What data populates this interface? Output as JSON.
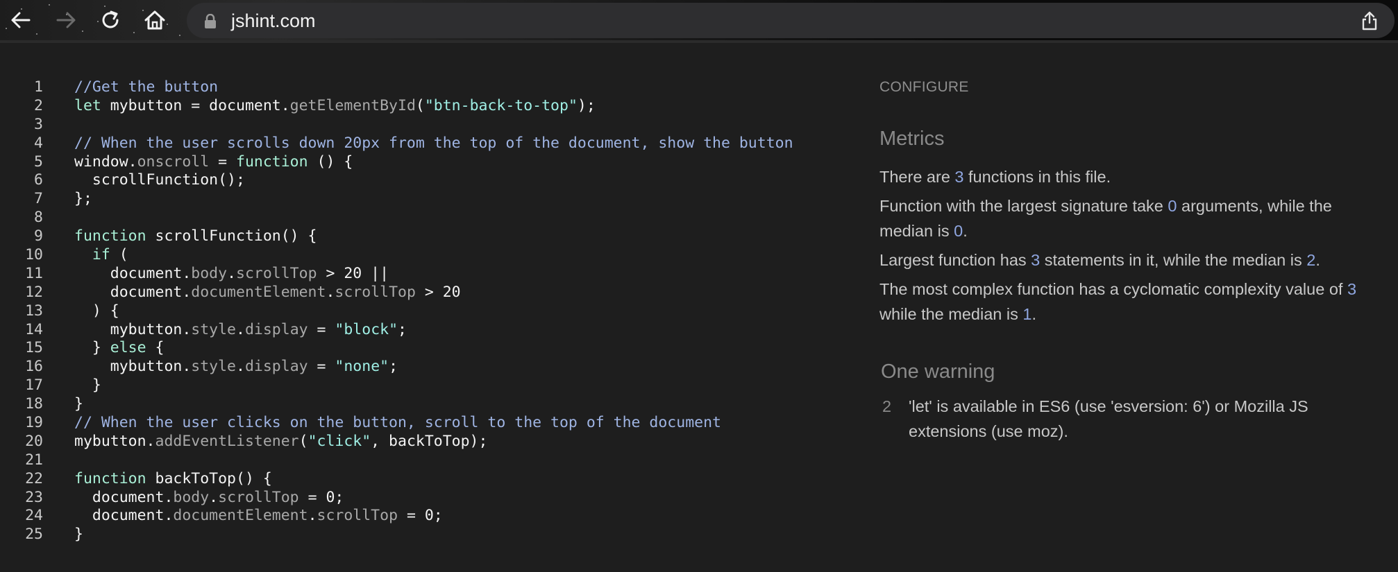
{
  "browser": {
    "url": "jshint.com"
  },
  "code": {
    "lines": [
      {
        "n": "1",
        "tokens": [
          {
            "t": "//Get the button",
            "c": "comment"
          }
        ]
      },
      {
        "n": "2",
        "tokens": [
          {
            "t": "let",
            "c": "keyword"
          },
          {
            "t": " mybutton = document.",
            "c": "plain"
          },
          {
            "t": "getElementById",
            "c": "prop"
          },
          {
            "t": "(",
            "c": "plain"
          },
          {
            "t": "\"btn-back-to-top\"",
            "c": "string"
          },
          {
            "t": ");",
            "c": "plain"
          }
        ]
      },
      {
        "n": "3",
        "tokens": []
      },
      {
        "n": "4",
        "tokens": [
          {
            "t": "// When the user scrolls down 20px from the top of the document, show the button",
            "c": "comment"
          }
        ]
      },
      {
        "n": "5",
        "tokens": [
          {
            "t": "window.",
            "c": "plain"
          },
          {
            "t": "onscroll",
            "c": "prop"
          },
          {
            "t": " = ",
            "c": "plain"
          },
          {
            "t": "function",
            "c": "keyword"
          },
          {
            "t": " () {",
            "c": "plain"
          }
        ]
      },
      {
        "n": "6",
        "tokens": [
          {
            "t": "  scrollFunction();",
            "c": "plain"
          }
        ]
      },
      {
        "n": "7",
        "tokens": [
          {
            "t": "};",
            "c": "plain"
          }
        ]
      },
      {
        "n": "8",
        "tokens": []
      },
      {
        "n": "9",
        "tokens": [
          {
            "t": "function",
            "c": "keyword"
          },
          {
            "t": " scrollFunction() {",
            "c": "plain"
          }
        ]
      },
      {
        "n": "10",
        "tokens": [
          {
            "t": "  ",
            "c": "plain"
          },
          {
            "t": "if",
            "c": "keyword"
          },
          {
            "t": " (",
            "c": "plain"
          }
        ]
      },
      {
        "n": "11",
        "tokens": [
          {
            "t": "    document.",
            "c": "plain"
          },
          {
            "t": "body",
            "c": "prop"
          },
          {
            "t": ".",
            "c": "plain"
          },
          {
            "t": "scrollTop",
            "c": "prop"
          },
          {
            "t": " > 20 ||",
            "c": "plain"
          }
        ]
      },
      {
        "n": "12",
        "tokens": [
          {
            "t": "    document.",
            "c": "plain"
          },
          {
            "t": "documentElement",
            "c": "prop"
          },
          {
            "t": ".",
            "c": "plain"
          },
          {
            "t": "scrollTop",
            "c": "prop"
          },
          {
            "t": " > 20",
            "c": "plain"
          }
        ]
      },
      {
        "n": "13",
        "tokens": [
          {
            "t": "  ) {",
            "c": "plain"
          }
        ]
      },
      {
        "n": "14",
        "tokens": [
          {
            "t": "    mybutton.",
            "c": "plain"
          },
          {
            "t": "style",
            "c": "prop"
          },
          {
            "t": ".",
            "c": "plain"
          },
          {
            "t": "display",
            "c": "prop"
          },
          {
            "t": " = ",
            "c": "plain"
          },
          {
            "t": "\"block\"",
            "c": "string"
          },
          {
            "t": ";",
            "c": "plain"
          }
        ]
      },
      {
        "n": "15",
        "tokens": [
          {
            "t": "  } ",
            "c": "plain"
          },
          {
            "t": "else",
            "c": "keyword"
          },
          {
            "t": " {",
            "c": "plain"
          }
        ]
      },
      {
        "n": "16",
        "tokens": [
          {
            "t": "    mybutton.",
            "c": "plain"
          },
          {
            "t": "style",
            "c": "prop"
          },
          {
            "t": ".",
            "c": "plain"
          },
          {
            "t": "display",
            "c": "prop"
          },
          {
            "t": " = ",
            "c": "plain"
          },
          {
            "t": "\"none\"",
            "c": "string"
          },
          {
            "t": ";",
            "c": "plain"
          }
        ]
      },
      {
        "n": "17",
        "tokens": [
          {
            "t": "  }",
            "c": "plain"
          }
        ]
      },
      {
        "n": "18",
        "tokens": [
          {
            "t": "}",
            "c": "plain"
          }
        ]
      },
      {
        "n": "19",
        "tokens": [
          {
            "t": "// When the user clicks on the button, scroll to the top of the document",
            "c": "comment"
          }
        ]
      },
      {
        "n": "20",
        "tokens": [
          {
            "t": "mybutton.",
            "c": "plain"
          },
          {
            "t": "addEventListener",
            "c": "prop"
          },
          {
            "t": "(",
            "c": "plain"
          },
          {
            "t": "\"click\"",
            "c": "string"
          },
          {
            "t": ", backToTop);",
            "c": "plain"
          }
        ]
      },
      {
        "n": "21",
        "tokens": []
      },
      {
        "n": "22",
        "tokens": [
          {
            "t": "function",
            "c": "keyword"
          },
          {
            "t": " backToTop() {",
            "c": "plain"
          }
        ]
      },
      {
        "n": "23",
        "tokens": [
          {
            "t": "  document.",
            "c": "plain"
          },
          {
            "t": "body",
            "c": "prop"
          },
          {
            "t": ".",
            "c": "plain"
          },
          {
            "t": "scrollTop",
            "c": "prop"
          },
          {
            "t": " = 0;",
            "c": "plain"
          }
        ]
      },
      {
        "n": "24",
        "tokens": [
          {
            "t": "  document.",
            "c": "plain"
          },
          {
            "t": "documentElement",
            "c": "prop"
          },
          {
            "t": ".",
            "c": "plain"
          },
          {
            "t": "scrollTop",
            "c": "prop"
          },
          {
            "t": " = 0;",
            "c": "plain"
          }
        ]
      },
      {
        "n": "25",
        "tokens": [
          {
            "t": "}",
            "c": "plain"
          }
        ]
      }
    ]
  },
  "panel": {
    "configure_label": "CONFIGURE",
    "metrics_title": "Metrics",
    "metrics": {
      "functions": {
        "pre": "There are ",
        "num": "3",
        "post": " functions in this file."
      },
      "signature": {
        "pre": "Function with the largest signature take ",
        "num1": "0",
        "mid": " arguments, while the median is ",
        "num2": "0",
        "post": "."
      },
      "statements": {
        "pre": "Largest function has ",
        "num1": "3",
        "mid": " statements in it, while the median is ",
        "num2": "2",
        "post": "."
      },
      "complexity": {
        "pre": "The most complex function has a cyclomatic complexity value of ",
        "num1": "3",
        "mid": " while the median is ",
        "num2": "1",
        "post": "."
      }
    },
    "warnings_title": "One warning",
    "warnings": [
      {
        "line": "2",
        "text": "'let' is available in ES6 (use 'esversion: 6') or Mozilla JS extensions (use moz)."
      }
    ]
  },
  "colors": {
    "background": "#1e1e1e",
    "comment": "#9fb4e3",
    "keyword": "#a9efd6",
    "string": "#9feee4",
    "property": "#a9a9a9",
    "number_highlight": "#8fa6e0"
  }
}
